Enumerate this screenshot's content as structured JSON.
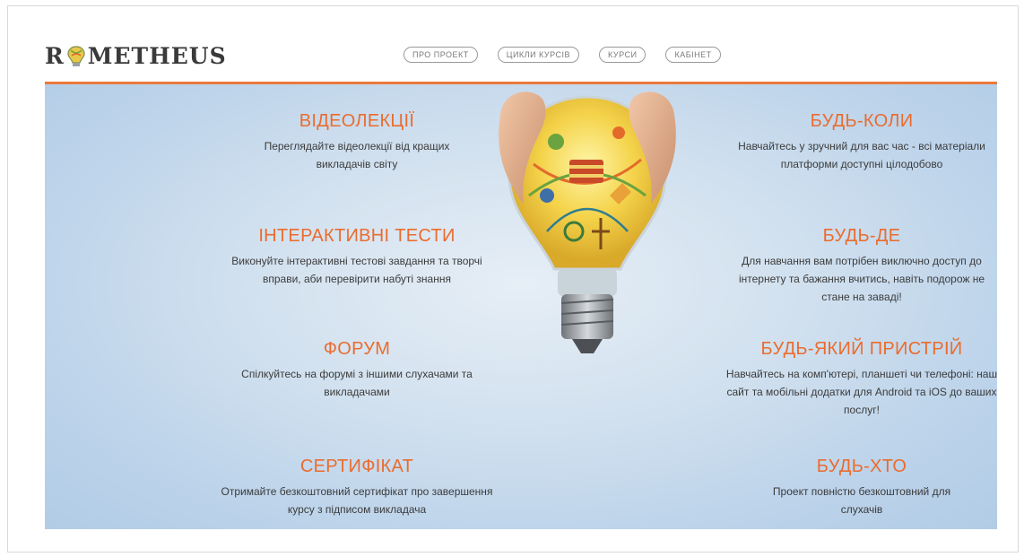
{
  "brand": {
    "logo_left": "R",
    "logo_right": "METHEUS",
    "accent_color": "#ea6c2e"
  },
  "nav": {
    "items": [
      {
        "label": "ПРО ПРОЕКТ"
      },
      {
        "label": "ЦИКЛИ КУРСІВ"
      },
      {
        "label": "КУРСИ"
      },
      {
        "label": "КАБІНЕТ"
      }
    ]
  },
  "features": {
    "left": [
      {
        "title": "ВІДЕОЛЕКЦІЇ",
        "text": "Переглядайте відеолекції від кращих викладачів світу"
      },
      {
        "title": "ІНТЕРАКТИВНІ ТЕСТИ",
        "text": "Виконуйте інтерактивні тестові завдання та творчі вправи, аби перевірити набуті знання"
      },
      {
        "title": "ФОРУМ",
        "text": "Спілкуйтесь на форумі з іншими слухачами та викладачами"
      },
      {
        "title": "СЕРТИФІКАТ",
        "text": "Отримайте безкоштовний сертифікат про завершення курсу з підписом викладача"
      }
    ],
    "right": [
      {
        "title": "БУДЬ-КОЛИ",
        "text": "Навчайтесь у зручний для вас час - всі матеріали платформи доступні цілодобово"
      },
      {
        "title": "БУДЬ-ДЕ",
        "text": "Для навчання вам потрібен виключно доступ до інтернету та бажання вчитись, навіть подорож не стане на заваді!"
      },
      {
        "title": "БУДЬ-ЯКИЙ ПРИСТРІЙ",
        "text": "Навчайтесь на комп'ютері, планшеті чи телефоні: наш сайт та мобільні додатки для Android та iOS до ваших послуг!"
      },
      {
        "title": "БУДЬ-ХТО",
        "text": "Проект повністю безкоштовний для слухачів"
      }
    ]
  },
  "hero_illustration": {
    "icon": "lightbulb-in-hands-icon"
  }
}
